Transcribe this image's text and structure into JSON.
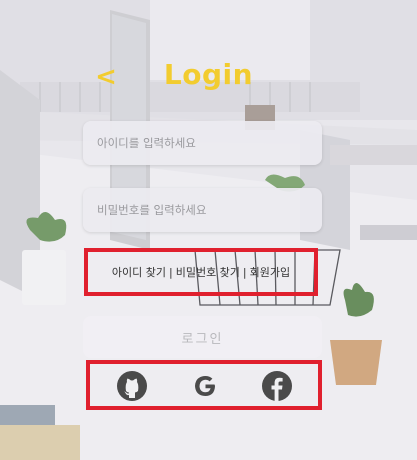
{
  "header": {
    "title": "Login",
    "back_glyph": "<"
  },
  "form": {
    "id_placeholder": "아이디를 입력하세요",
    "pw_placeholder": "비밀번호를 입력하세요"
  },
  "links": {
    "find_id": "아이디 찾기",
    "find_pw": "비밀번호 찾기",
    "signup": "회원가입",
    "separator": "|"
  },
  "login_button": "로그인",
  "social": [
    {
      "name": "github-icon"
    },
    {
      "name": "google-icon"
    },
    {
      "name": "facebook-icon"
    }
  ],
  "colors": {
    "accent": "#f2cc2f",
    "highlight": "#e0202e",
    "icon": "#4a4a4a"
  }
}
